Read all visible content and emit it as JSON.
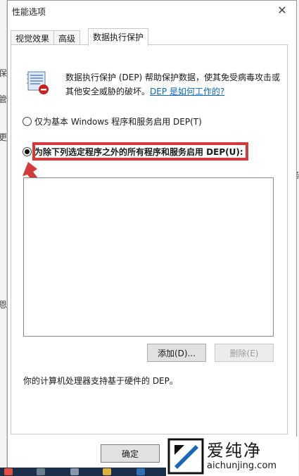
{
  "window": {
    "title": "性能选项"
  },
  "tabs": [
    {
      "label": "视觉效果",
      "active": false
    },
    {
      "label": "高级",
      "active": false
    },
    {
      "label": "数据执行保护",
      "active": true
    }
  ],
  "description": {
    "text": "数据执行保护 (DEP) 帮助保护数据，使其免受病毒攻击或其他安全威胁的破坏。",
    "link": "DEP 是如何工作的?"
  },
  "options": {
    "basic": "仅为基本 Windows 程序和服务启用 DEP(T)",
    "all_except": "为除下列选定程序之外的所有程序和服务启用 DEP(U):",
    "selected": "all_except"
  },
  "buttons": {
    "add": "添加(D)...",
    "delete": "删除(E)",
    "ok": "确定"
  },
  "support_text": "你的计算机处理器支持基于硬件的 DEP。",
  "watermark": {
    "brand": "爱纯净",
    "url": "aichunjing.com"
  },
  "background_glyphs": {
    "left": [
      "保",
      "管",
      "更",
      "恩"
    ],
    "right": [
      "务"
    ]
  },
  "colors": {
    "highlight": "#d33a3a",
    "link": "#0b67c2",
    "taskbar": "#1c2f4a"
  }
}
